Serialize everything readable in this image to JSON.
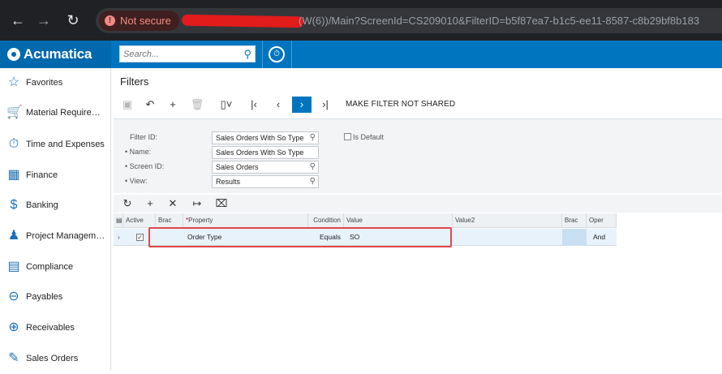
{
  "browser": {
    "not_secure": "Not secure",
    "url": "(W(6))/Main?ScreenId=CS209010&FilterID=b5f87ea7-b1c5-ee11-8587-c8b29bf8b183"
  },
  "header": {
    "logo_text": "Acumatica",
    "search_placeholder": "Search..."
  },
  "sidebar": {
    "items": [
      {
        "label": "Favorites",
        "icon": "star-icon"
      },
      {
        "label": "Material Requirem…",
        "icon": "cart-icon"
      },
      {
        "label": "Time and Expenses",
        "icon": "stopwatch-icon"
      },
      {
        "label": "Finance",
        "icon": "calculator-icon"
      },
      {
        "label": "Banking",
        "icon": "dollar-icon"
      },
      {
        "label": "Project Management",
        "icon": "person-icon"
      },
      {
        "label": "Compliance",
        "icon": "document-icon"
      },
      {
        "label": "Payables",
        "icon": "minus-circle-icon"
      },
      {
        "label": "Receivables",
        "icon": "plus-circle-icon"
      },
      {
        "label": "Sales Orders",
        "icon": "edit-icon"
      }
    ]
  },
  "page": {
    "title": "Filters",
    "make_filter_label": "MAKE FILTER NOT SHARED"
  },
  "form": {
    "filter_id_label": "Filter ID:",
    "filter_id_value": "Sales Orders With So Type",
    "name_label": "Name:",
    "name_value": "Sales Orders With So Type",
    "screen_id_label": "Screen ID:",
    "screen_id_value": "Sales Orders",
    "view_label": "View:",
    "view_value": "Results",
    "is_default_label": "Is Default"
  },
  "grid": {
    "headers": {
      "active": "Active",
      "brac_open": "Brac",
      "property_required": "*",
      "property": "Property",
      "condition": "Condition",
      "value": "Value",
      "value2": "Value2",
      "brac_close": "Brac",
      "operator": "Oper"
    },
    "row": {
      "property": "Order Type",
      "condition": "Equals",
      "value": "SO",
      "operator": "And",
      "active_checked": true
    }
  },
  "colors": {
    "accent": "#0075bf",
    "highlight_border": "#e0474c"
  }
}
